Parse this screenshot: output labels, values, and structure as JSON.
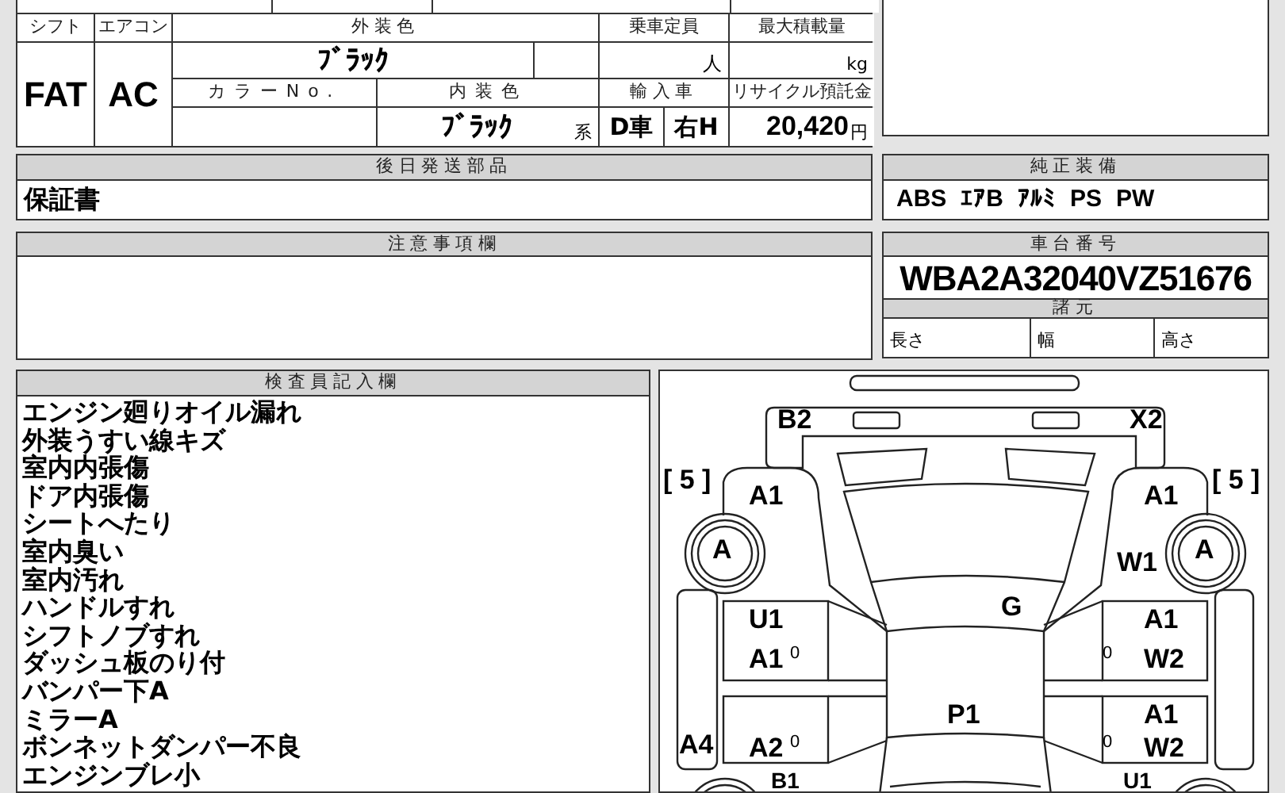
{
  "spec_table": {
    "labels": {
      "shift": "シフト",
      "ac": "エアコン",
      "exterior_color": "外装色",
      "capacity": "乗車定員",
      "max_load": "最大積載量",
      "color_no": "カラーNo.",
      "interior_color": "内装色",
      "import": "輸入車",
      "recycle_fee": "リサイクル預託金"
    },
    "values": {
      "shift": "FAT",
      "ac": "AC",
      "exterior_color": "ﾌﾞﾗｯｸ",
      "capacity_unit": "人",
      "max_load_unit": "kg",
      "interior_color": "ﾌﾞﾗｯｸ",
      "interior_suffix": "系",
      "import_type": "D車",
      "steering": "右H",
      "recycle_fee": "20,420",
      "recycle_unit": "円"
    }
  },
  "later_parts": {
    "header": "後日発送部品",
    "value": "保証書"
  },
  "notes": {
    "header": "注意事項欄"
  },
  "equipment": {
    "header": "純正装備",
    "items": [
      "ABS",
      "ｴｱB",
      "ｱﾙﾐ",
      "PS",
      "PW"
    ]
  },
  "chassis": {
    "header": "車台番号",
    "number": "WBA2A32040VZ51676",
    "specs_header": "諸元",
    "specs": [
      "長さ",
      "幅",
      "高さ"
    ]
  },
  "inspector": {
    "header": "検査員記入欄",
    "items": [
      "エンジン廻りオイル漏れ",
      "外装うすい線キズ",
      "室内内張傷",
      "ドア内張傷",
      "シートへたり",
      "室内臭い",
      "室内汚れ",
      "ハンドルすれ",
      "シフトノブすれ",
      "ダッシュ板のり付",
      "バンパー下A",
      "ミラーA",
      "ボンネットダンパー不良",
      "エンジンブレ小"
    ]
  },
  "diagram": {
    "labels": [
      "B2",
      "X2",
      "[ 5 ]",
      "[ 5 ]",
      "A1",
      "A1",
      "A",
      "A",
      "W1",
      "G",
      "U1",
      "A1",
      "0",
      "A1",
      "0",
      "W2",
      "P1",
      "A4",
      "A2",
      "0",
      "A1",
      "0",
      "W2",
      "B1",
      "U1"
    ]
  }
}
